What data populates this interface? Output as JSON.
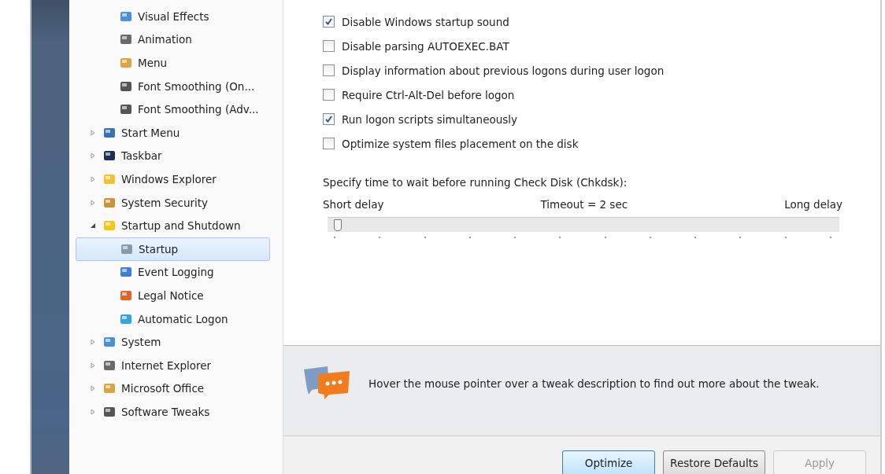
{
  "tree": [
    {
      "children": [
        {
          "label": "Visual Effects",
          "selected": false
        },
        {
          "label": "Animation",
          "selected": false
        },
        {
          "label": "Menu",
          "selected": false
        },
        {
          "label": "Font Smoothing (On...",
          "selected": false
        },
        {
          "label": "Font Smoothing (Adv...",
          "selected": false
        }
      ]
    },
    {
      "label": "Start Menu",
      "expanded": false,
      "selected": false
    },
    {
      "label": "Taskbar",
      "expanded": false,
      "selected": false
    },
    {
      "label": "Windows Explorer",
      "expanded": false,
      "selected": false
    },
    {
      "label": "System Security",
      "expanded": false,
      "selected": false
    },
    {
      "label": "Startup and Shutdown",
      "expanded": true,
      "selected": false,
      "children": [
        {
          "label": "Startup",
          "selected": true
        },
        {
          "label": "Event Logging",
          "selected": false
        },
        {
          "label": "Legal Notice",
          "selected": false
        },
        {
          "label": "Automatic Logon",
          "selected": false
        }
      ]
    },
    {
      "label": "System",
      "expanded": false,
      "selected": false
    },
    {
      "label": "Internet Explorer",
      "expanded": false,
      "selected": false
    },
    {
      "label": "Microsoft Office",
      "expanded": false,
      "selected": false
    },
    {
      "label": "Software Tweaks",
      "expanded": false,
      "selected": false
    }
  ],
  "options": [
    {
      "label": "Disable Windows startup sound",
      "checked": true
    },
    {
      "label": "Disable parsing AUTOEXEC.BAT",
      "checked": false
    },
    {
      "label": "Display information about previous logons during user logon",
      "checked": false
    },
    {
      "label": "Require Ctrl-Alt-Del before logon",
      "checked": false
    },
    {
      "label": "Run logon scripts simultaneously",
      "checked": true
    },
    {
      "label": "Optimize system files placement on the disk",
      "checked": false
    }
  ],
  "slider": {
    "caption": "Specify time to wait before running Check Disk (Chkdsk):",
    "min_label": "Short delay",
    "reading": "Timeout = 2 sec",
    "max_label": "Long delay",
    "level": 0.01
  },
  "info": {
    "text": "Hover the mouse pointer over a tweak description to find out more about the tweak."
  },
  "buttons": [
    {
      "label": "Optimize",
      "default": true,
      "disabled": false
    },
    {
      "label": "Restore Defaults",
      "default": false,
      "disabled": false
    },
    {
      "label": "Apply",
      "default": false,
      "disabled": true
    }
  ]
}
